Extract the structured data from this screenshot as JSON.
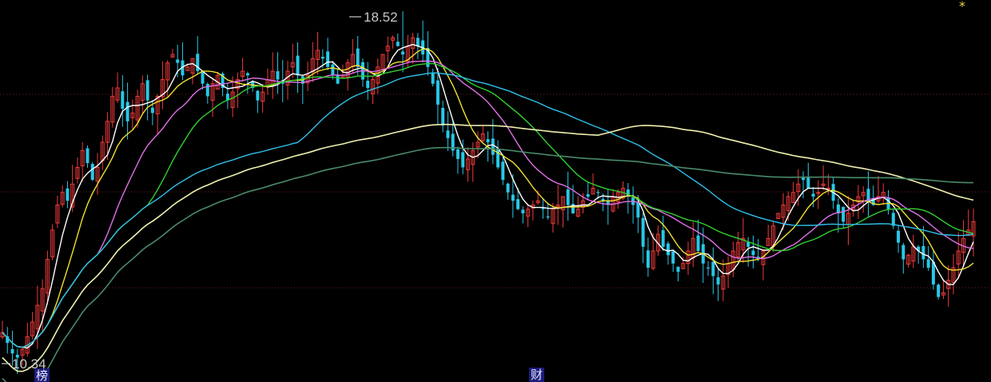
{
  "chart_data": {
    "type": "candlestick",
    "title": "",
    "price_high_label": "18.52",
    "price_low_label": "10.34",
    "price_range": [
      10.34,
      18.52
    ],
    "grid": "dotted-horizontal",
    "colors": {
      "up": "#f03a3a",
      "down": "#28c8e6",
      "grid": "#7a1c1c",
      "background": "#000000"
    },
    "close": [
      10.95,
      10.7,
      10.45,
      10.35,
      10.55,
      10.85,
      11.2,
      11.6,
      12.0,
      12.7,
      13.4,
      14.0,
      14.3,
      14.1,
      14.5,
      14.9,
      15.3,
      15.0,
      14.6,
      14.9,
      15.5,
      16.0,
      16.6,
      16.8,
      16.3,
      16.0,
      16.2,
      16.6,
      16.9,
      16.5,
      16.2,
      16.6,
      17.0,
      17.4,
      17.6,
      17.4,
      17.1,
      17.3,
      17.5,
      17.2,
      16.9,
      16.6,
      16.9,
      17.1,
      16.8,
      16.5,
      16.7,
      17.0,
      17.2,
      17.1,
      16.8,
      16.5,
      16.7,
      17.0,
      17.2,
      17.0,
      16.9,
      17.2,
      17.4,
      17.1,
      16.9,
      17.1,
      17.5,
      17.7,
      17.5,
      17.3,
      17.1,
      16.9,
      17.1,
      17.4,
      17.6,
      17.3,
      17.0,
      16.8,
      17.0,
      17.3,
      17.6,
      17.8,
      18.0,
      17.8,
      17.6,
      17.8,
      18.0,
      17.8,
      17.6,
      17.3,
      16.9,
      16.4,
      15.9,
      15.6,
      15.3,
      15.1,
      14.9,
      15.1,
      15.3,
      15.5,
      15.7,
      15.5,
      15.2,
      14.9,
      14.6,
      14.3,
      14.1,
      13.9,
      13.8,
      13.9,
      14.0,
      14.1,
      13.9,
      13.7,
      13.9,
      14.0,
      14.2,
      14.0,
      13.8,
      13.9,
      14.1,
      14.2,
      14.4,
      14.3,
      14.1,
      14.0,
      14.2,
      14.3,
      14.4,
      14.2,
      14.0,
      13.7,
      13.0,
      12.5,
      12.9,
      13.3,
      13.0,
      12.8,
      12.6,
      12.4,
      12.6,
      12.9,
      13.2,
      12.9,
      12.6,
      12.5,
      12.3,
      12.1,
      12.3,
      12.6,
      12.9,
      13.1,
      13.2,
      13.0,
      12.8,
      12.7,
      12.9,
      13.2,
      13.5,
      13.8,
      14.0,
      14.2,
      14.3,
      14.5,
      14.6,
      14.4,
      14.2,
      14.3,
      14.5,
      14.4,
      14.1,
      13.8,
      13.6,
      13.8,
      14.0,
      14.2,
      14.3,
      14.1,
      14.0,
      14.2,
      14.3,
      13.9,
      13.5,
      13.1,
      12.7,
      12.8,
      13.0,
      12.9,
      12.7,
      12.5,
      12.1,
      11.8,
      11.9,
      12.2,
      12.5,
      12.9,
      13.2,
      13.4,
      13.6
    ],
    "series": [
      {
        "name": "",
        "color": "#ffffff",
        "period": 5
      },
      {
        "name": "",
        "color": "#f0e030",
        "period": 10
      },
      {
        "name": "",
        "color": "#e070e8",
        "period": 20
      },
      {
        "name": "",
        "color": "#30d030",
        "period": 30
      },
      {
        "name": "",
        "color": "#30c0e8",
        "period": 60
      },
      {
        "name": "",
        "color": "#f0f0b0",
        "period": 120
      },
      {
        "name": "",
        "color": "#4a8a6a",
        "period": 250
      }
    ],
    "markers": [
      {
        "text": "榜",
        "position": "bottom-left"
      },
      {
        "text": "财",
        "position": "bottom-center"
      }
    ],
    "corner_symbol": "*"
  }
}
